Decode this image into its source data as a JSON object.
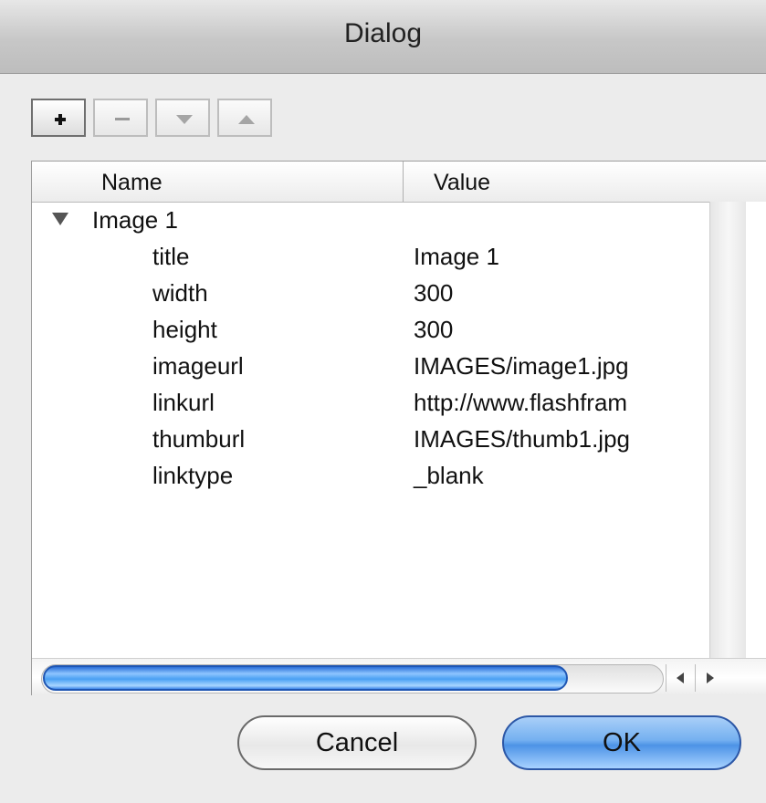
{
  "window": {
    "title": "Dialog"
  },
  "toolbar": {
    "add": "add-icon",
    "remove": "remove-icon",
    "move_down": "arrow-down-icon",
    "move_up": "arrow-up-icon"
  },
  "table": {
    "columns": [
      "Name",
      "Value"
    ],
    "group": {
      "label": "Image 1",
      "expanded": true
    },
    "rows": [
      {
        "name": "title",
        "value": "Image 1"
      },
      {
        "name": "width",
        "value": "300"
      },
      {
        "name": "height",
        "value": "300"
      },
      {
        "name": "imageurl",
        "value": "IMAGES/image1.jpg"
      },
      {
        "name": "linkurl",
        "value": "http://www.flashfram"
      },
      {
        "name": "thumburl",
        "value": "IMAGES/thumb1.jpg"
      },
      {
        "name": "linktype",
        "value": "_blank"
      }
    ]
  },
  "buttons": {
    "cancel": "Cancel",
    "ok": "OK"
  },
  "colors": {
    "accent": "#4d93e6",
    "window_bg": "#ececec"
  }
}
